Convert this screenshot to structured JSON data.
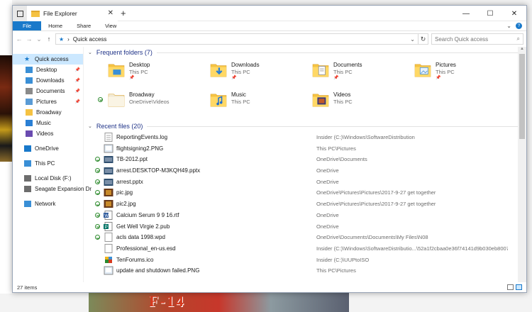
{
  "window": {
    "title": "File Explorer"
  },
  "ribbon": {
    "tabs": [
      "File",
      "Home",
      "Share",
      "View"
    ]
  },
  "address": {
    "path": "Quick access",
    "search_placeholder": "Search Quick access"
  },
  "nav": {
    "items": [
      {
        "label": "Quick access",
        "icon": "star-icon",
        "selected": true,
        "pinned": false
      },
      {
        "label": "Desktop",
        "icon": "desktop-icon",
        "pinned": true
      },
      {
        "label": "Downloads",
        "icon": "download-icon",
        "pinned": true
      },
      {
        "label": "Documents",
        "icon": "documents-icon",
        "pinned": true
      },
      {
        "label": "Pictures",
        "icon": "pictures-icon",
        "pinned": true
      },
      {
        "label": "Broadway",
        "icon": "folder-icon",
        "pinned": false
      },
      {
        "label": "Music",
        "icon": "music-icon",
        "pinned": false
      },
      {
        "label": "Videos",
        "icon": "videos-icon",
        "pinned": false
      },
      {
        "label": "OneDrive",
        "icon": "onedrive-icon",
        "pinned": false
      },
      {
        "label": "This PC",
        "icon": "pc-icon",
        "pinned": false
      },
      {
        "label": "Local Disk (F:)",
        "icon": "drive-icon",
        "pinned": false
      },
      {
        "label": "Seagate Expansion Dr",
        "icon": "drive-icon",
        "pinned": false
      },
      {
        "label": "Network",
        "icon": "network-icon",
        "pinned": false
      }
    ]
  },
  "frequent": {
    "header": "Frequent folders (7)",
    "folders": [
      {
        "name": "Desktop",
        "location": "This PC",
        "pinned": true,
        "synced": false
      },
      {
        "name": "Downloads",
        "location": "This PC",
        "pinned": true,
        "synced": false
      },
      {
        "name": "Documents",
        "location": "This PC",
        "pinned": true,
        "synced": false
      },
      {
        "name": "Pictures",
        "location": "This PC",
        "pinned": true,
        "synced": false
      },
      {
        "name": "Broadway",
        "location": "OneDrive\\Videos",
        "pinned": false,
        "synced": true
      },
      {
        "name": "Music",
        "location": "This PC",
        "pinned": false,
        "synced": false
      },
      {
        "name": "Videos",
        "location": "This PC",
        "pinned": false,
        "synced": false
      }
    ]
  },
  "recent": {
    "header": "Recent files (20)",
    "files": [
      {
        "name": "ReportingEvents.log",
        "location": "Insider (C:)\\Windows\\SoftwareDistribution",
        "synced": false,
        "icon": "log-icon"
      },
      {
        "name": "flightsigning2.PNG",
        "location": "This PC\\Pictures",
        "synced": false,
        "icon": "image-icon"
      },
      {
        "name": "TB-2012.ppt",
        "location": "OneDrive\\Documents",
        "synced": true,
        "icon": "ppt-icon"
      },
      {
        "name": "arrest.DESKTOP-M3KQH49.pptx",
        "location": "OneDrive",
        "synced": true,
        "icon": "ppt-icon"
      },
      {
        "name": "arrest.pptx",
        "location": "OneDrive",
        "synced": true,
        "icon": "ppt-icon"
      },
      {
        "name": "pic.jpg",
        "location": "OneDrive\\Pictures\\Pictures\\2017-9-27 get together",
        "synced": true,
        "icon": "photo-icon"
      },
      {
        "name": "pic2.jpg",
        "location": "OneDrive\\Pictures\\Pictures\\2017-9-27 get together",
        "synced": true,
        "icon": "photo-icon"
      },
      {
        "name": "Calcium Serum 9 9 16.rtf",
        "location": "OneDrive",
        "synced": true,
        "icon": "word-icon"
      },
      {
        "name": "Get Well Virgie 2.pub",
        "location": "OneDrive",
        "synced": true,
        "icon": "publisher-icon"
      },
      {
        "name": "acls data 1998.wpd",
        "location": "OneDrive\\Documents\\Documents\\My Files\\N08",
        "synced": true,
        "icon": "doc-icon"
      },
      {
        "name": "Professional_en-us.esd",
        "location": "Insider (C:)\\Windows\\SoftwareDistributio...\\52a1f2cbaa0e36f74141d9b030eb8007",
        "synced": false,
        "icon": "doc-icon"
      },
      {
        "name": "TenForums.ico",
        "location": "Insider (C:)\\UUPtoISO",
        "synced": false,
        "icon": "ico-icon"
      },
      {
        "name": "update and shutdown failed.PNG",
        "location": "This PC\\Pictures",
        "synced": false,
        "icon": "image-icon"
      }
    ]
  },
  "status": {
    "items_count": "27 items"
  },
  "background": {
    "game_title": "F-14"
  },
  "colors": {
    "accent": "#1979ca",
    "section_header": "#1e3287",
    "selected_bg": "#cce8ff",
    "folder": "#f5c242",
    "sync_green": "#2d8a2d"
  }
}
